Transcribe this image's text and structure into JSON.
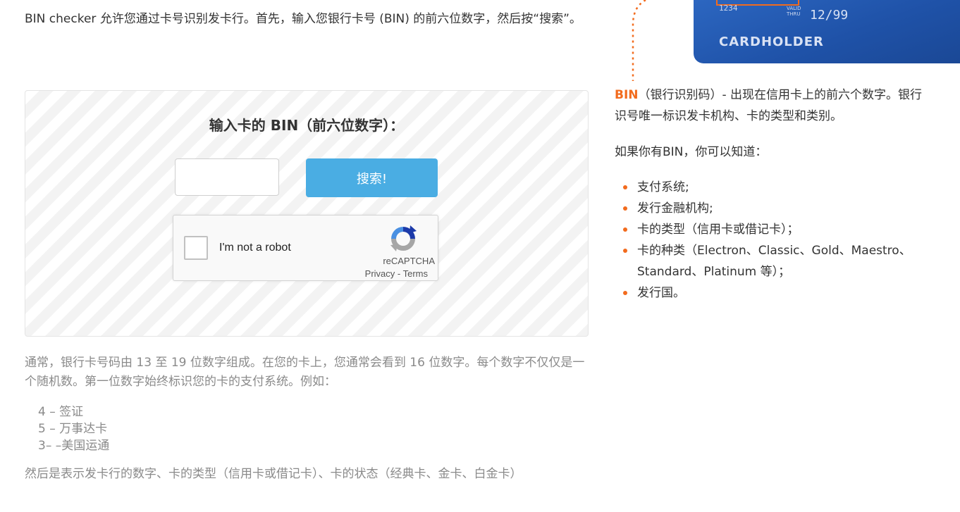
{
  "intro": {
    "text": "BIN checker 允许您通过卡号识别发卡行。首先，输入您银行卡号 (BIN) 的前六位数字，然后按“搜索”。"
  },
  "checker": {
    "title": "输入卡的 BIN（前六位数字）：",
    "input_value": "",
    "search_label": "搜索!"
  },
  "recaptcha": {
    "label": "I'm not a robot",
    "brand": "reCAPTCHA",
    "privacy": "Privacy",
    "separator": " - ",
    "terms": "Terms"
  },
  "explain": {
    "text": "通常，银行卡号码由 13 至 19 位数字组成。在您的卡上，您通常会看到 16 位数字。每个数字不仅仅是一个随机数。第一位数字始终标识您的卡的支付系统。例如：",
    "examples": [
      "4 – 签证",
      "5 – 万事达卡",
      "3– –美国运通"
    ],
    "after": "然后是表示发卡行的数字、卡的类型（信用卡或借记卡）、卡的状态（经典卡、金卡、白金卡）"
  },
  "card": {
    "small_number": "1234",
    "expiry_label_1": "VALID",
    "expiry_label_2": "THRU",
    "expiry": "12/99",
    "holder": "CARDHOLDER"
  },
  "sidebar": {
    "bin_word": "BIN",
    "bin_def_1": "（银行识别码）- 出现在信用卡上的前六个数字。银行",
    "bin_def_2": "识号唯一标识发卡机构、卡的类型和类别。",
    "if_bin": "如果你有BIN，你可以知道：",
    "items": [
      "支付系统;",
      "发行金融机构;",
      "卡的类型（信用卡或借记卡）；",
      "卡的种类（Electron、Classic、Gold、Maestro、Standard、Platinum 等）；",
      "发行国。"
    ]
  },
  "colors": {
    "accent": "#f26b1d",
    "button": "#4aade3",
    "card": "#2f6bc6"
  }
}
